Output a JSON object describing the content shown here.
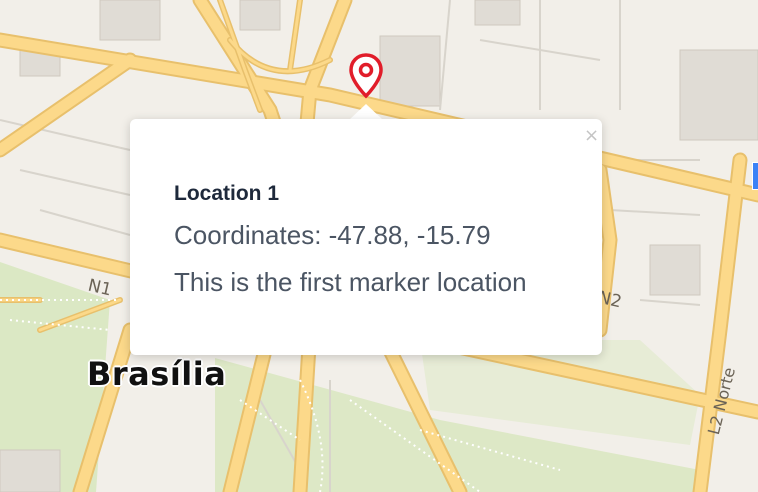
{
  "map": {
    "place_label": "Brasília",
    "road_labels": {
      "n1": "N1",
      "n2": "N2",
      "l2_norte": "L2 Norte"
    }
  },
  "marker": {
    "icon": "map-pin-icon",
    "color": "#e11d2a"
  },
  "popup": {
    "title": "Location 1",
    "coordinates": "Coordinates: -47.88, -15.79",
    "description": "This is the first marker location",
    "close_glyph": "×"
  },
  "colors": {
    "road_fill": "#fcd98a",
    "road_casing": "#e8c06c",
    "park": "#dbe8c4",
    "land": "#f2efe9",
    "building": "#e0dcd5"
  }
}
